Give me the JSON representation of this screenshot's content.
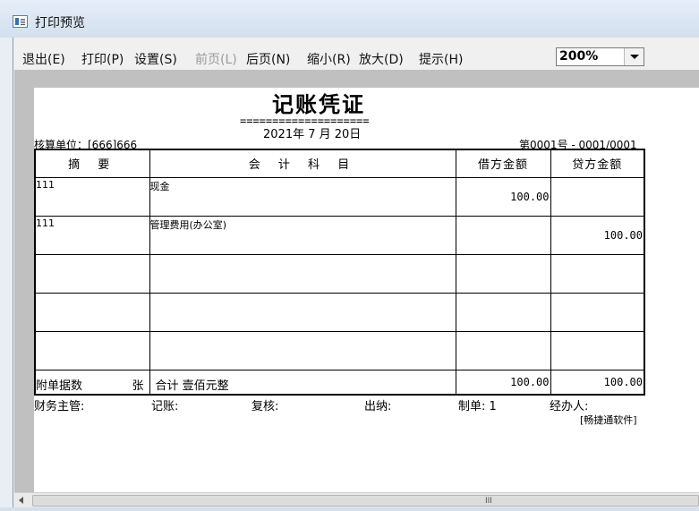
{
  "window": {
    "title": "打印预览"
  },
  "menu": {
    "items": [
      {
        "label": "退出(E)",
        "enabled": true
      },
      {
        "label": "打印(P)",
        "enabled": true
      },
      {
        "label": "设置(S)",
        "enabled": true
      },
      {
        "label": "前页(L)",
        "enabled": false
      },
      {
        "label": "后页(N)",
        "enabled": true
      },
      {
        "label": "缩小(R)",
        "enabled": true
      },
      {
        "label": "放大(D)",
        "enabled": true
      },
      {
        "label": "提示(H)",
        "enabled": true
      }
    ]
  },
  "zoom": {
    "value": "200%"
  },
  "voucher": {
    "title": "记账凭证",
    "rule": "====================",
    "date": "2021年 7 月 20日",
    "unit": "核算单位：[666]666",
    "number": "第0001号 - 0001/0001",
    "headers": {
      "summary": "摘 要",
      "account": "会 计 科 目",
      "debit": "借方金额",
      "credit": "贷方金额"
    },
    "rows": [
      {
        "summary": "111",
        "account": "现金",
        "debit": "100.00",
        "credit": ""
      },
      {
        "summary": "111",
        "account": "管理费用(办公室)",
        "debit": "",
        "credit": "100.00"
      },
      {
        "summary": "",
        "account": "",
        "debit": "",
        "credit": ""
      },
      {
        "summary": "",
        "account": "",
        "debit": "",
        "credit": ""
      },
      {
        "summary": "",
        "account": "",
        "debit": "",
        "credit": ""
      }
    ],
    "footer": {
      "attachments_label": "附单据数",
      "attachments_unit": "张",
      "total_label": "合计 壹佰元整",
      "debit_total": "100.00",
      "credit_total": "100.00"
    },
    "signatures": {
      "supervisor": "财务主管:",
      "bookkeeper": "记账:",
      "reviewer": "复核:",
      "cashier": "出纳:",
      "preparer": "制单: 1",
      "handler": "经办人:"
    },
    "software": "[畅捷通软件]"
  },
  "scrollbar": {
    "grip": "III"
  }
}
